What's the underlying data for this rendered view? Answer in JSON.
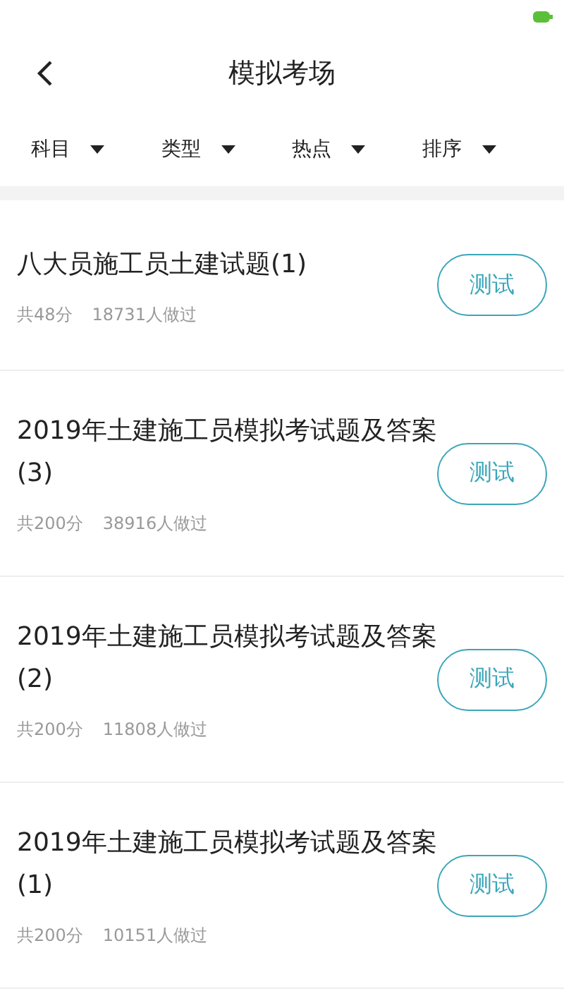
{
  "header": {
    "title": "模拟考场"
  },
  "filters": [
    {
      "label": "科目"
    },
    {
      "label": "类型"
    },
    {
      "label": "热点"
    },
    {
      "label": "排序"
    }
  ],
  "exams": [
    {
      "title": "八大员施工员土建试题(1)",
      "score": "共48分",
      "taken": "18731人做过",
      "action": "测试"
    },
    {
      "title": "2019年土建施工员模拟考试题及答案(3)",
      "score": "共200分",
      "taken": "38916人做过",
      "action": "测试"
    },
    {
      "title": "2019年土建施工员模拟考试题及答案(2)",
      "score": "共200分",
      "taken": "11808人做过",
      "action": "测试"
    },
    {
      "title": "2019年土建施工员模拟考试题及答案(1)",
      "score": "共200分",
      "taken": "10151人做过",
      "action": "测试"
    }
  ]
}
